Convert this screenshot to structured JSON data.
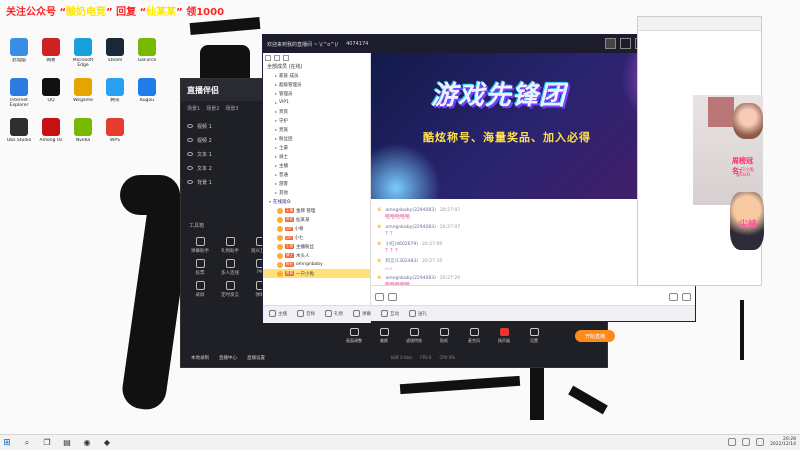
{
  "promo": {
    "part1": "关注公众号 “",
    "highlight1": "酸奶电竞",
    "part2": "” 回复 “",
    "highlight2": "仙某某",
    "part3": "” 领1000"
  },
  "desktop_icons": [
    {
      "label": "此电脑",
      "icon": "computer-icon",
      "color": "#3a8ee6"
    },
    {
      "label": "网易",
      "icon": "app-icon",
      "color": "#cc2222"
    },
    {
      "label": "Microsoft Edge",
      "icon": "edge-icon",
      "color": "#1aa0d8"
    },
    {
      "label": "Steam",
      "icon": "steam-icon",
      "color": "#1b2838"
    },
    {
      "label": "GeForce",
      "icon": "nvidia-icon",
      "color": "#76b900"
    },
    {
      "label": "Internet Explorer",
      "icon": "ie-icon",
      "color": "#2b7de2"
    },
    {
      "label": "QQ",
      "icon": "qq-icon",
      "color": "#111111"
    },
    {
      "label": "Wegame",
      "icon": "wegame-icon",
      "color": "#e6a400"
    },
    {
      "label": "腾讯",
      "icon": "tencent-icon",
      "color": "#2aa0f5"
    },
    {
      "label": "Kugou",
      "icon": "kugou-icon",
      "color": "#1e7de9"
    },
    {
      "label": "Obs Studio",
      "icon": "obs-icon",
      "color": "#302e31"
    },
    {
      "label": "Among Us",
      "icon": "game-icon",
      "color": "#c51111"
    },
    {
      "label": "Nvidia",
      "icon": "nvidia-icon",
      "color": "#76b900"
    },
    {
      "label": "WPS",
      "icon": "wps-icon",
      "color": "#e43d30"
    }
  ],
  "stream_app": {
    "logo": "直播伴侣",
    "tabs": [
      "场景1",
      "场景2",
      "场景3"
    ],
    "scenes": [
      "视频 1",
      "视频 2",
      "文本 1",
      "文本 2",
      "背景 1"
    ],
    "tools_label": "工具箱",
    "tools": [
      "弹幕助手",
      "礼物助手",
      "观众互动",
      "投票",
      "多人连线",
      "PK",
      "录屏",
      "定时发言",
      "弹幕"
    ],
    "controls": [
      {
        "label": "画面调整",
        "state": ""
      },
      {
        "label": "美颜",
        "state": ""
      },
      {
        "label": "滤镜特效",
        "state": ""
      },
      {
        "label": "贴纸",
        "state": ""
      },
      {
        "label": "麦克风",
        "state": ""
      },
      {
        "label": "扬声器",
        "state": "mic-off"
      },
      {
        "label": "设置",
        "state": ""
      }
    ],
    "start_label": "开始直播",
    "status": [
      "本地录制",
      "直播中心",
      "直播设置"
    ],
    "stats": [
      "码率 0 kb/s",
      "FPS 0",
      "CPU 0%"
    ]
  },
  "chat_window": {
    "title": "欢迎来到我的直播间 ~ \\(^o^)/",
    "room_id": "4074174",
    "member_title": "全部成员 (在线)",
    "groups": [
      {
        "name": "家族 成员",
        "open": false
      },
      {
        "name": "超级管理员",
        "open": false
      },
      {
        "name": "管理员",
        "open": false
      },
      {
        "name": "VIP1",
        "open": false
      },
      {
        "name": "贵宾",
        "open": false
      },
      {
        "name": "守护",
        "open": false
      },
      {
        "name": "贵族",
        "open": false
      },
      {
        "name": "粉丝团",
        "open": false
      },
      {
        "name": "土豪",
        "open": false
      },
      {
        "name": "骑士",
        "open": false
      },
      {
        "name": "主播",
        "open": false
      },
      {
        "name": "普通",
        "open": false
      },
      {
        "name": "游客",
        "open": false
      },
      {
        "name": "其他",
        "open": false
      },
      {
        "name": "在线观众",
        "open": true
      }
    ],
    "members": [
      {
        "name": "金牌 管理",
        "badge": "主播",
        "selected": false
      },
      {
        "name": "仙某某",
        "badge": "贵宾",
        "selected": false
      },
      {
        "name": "小骨",
        "badge": "VIP",
        "selected": false
      },
      {
        "name": "小七",
        "badge": "VIP",
        "selected": false
      },
      {
        "name": "主播粉丝",
        "badge": "土豪",
        "selected": false
      },
      {
        "name": "木头人",
        "badge": "骑士",
        "selected": false
      },
      {
        "name": "omngnbaby",
        "badge": "粉丝",
        "selected": false
      },
      {
        "name": "一只小兔",
        "badge": "贵族",
        "selected": true
      }
    ],
    "banner_title": "游戏先锋团",
    "banner_sub": "酷炫称号、海量奖品、加入必得",
    "messages": [
      {
        "user": "omngnbaby(2294083)",
        "time": "20:27:07",
        "body": "哈哈哈哈哈"
      },
      {
        "user": "omngnbaby(2294083)",
        "time": "20:27:07",
        "body": "？？"
      },
      {
        "user": "小红(4602679)",
        "time": "20:27:09",
        "body": "？？？"
      },
      {
        "user": "阿言(1302483)",
        "time": "20:27:10",
        "body": "。。。"
      },
      {
        "user": "omngnbaby(2294083)",
        "time": "20:27:29",
        "body": "哈哈哈哈哈"
      }
    ],
    "input_placeholder": "",
    "bottom_items": [
      "主播",
      "音频",
      "礼物",
      "弹幕",
      "互动",
      "送礼"
    ]
  },
  "live_window": {
    "ranking_title": "周榜冠名:",
    "ranking_name": "一只小兔@OvO",
    "cartoon_text": "尖峰"
  },
  "taskbar": {
    "time": "20:28",
    "date": "2022/12/14"
  }
}
